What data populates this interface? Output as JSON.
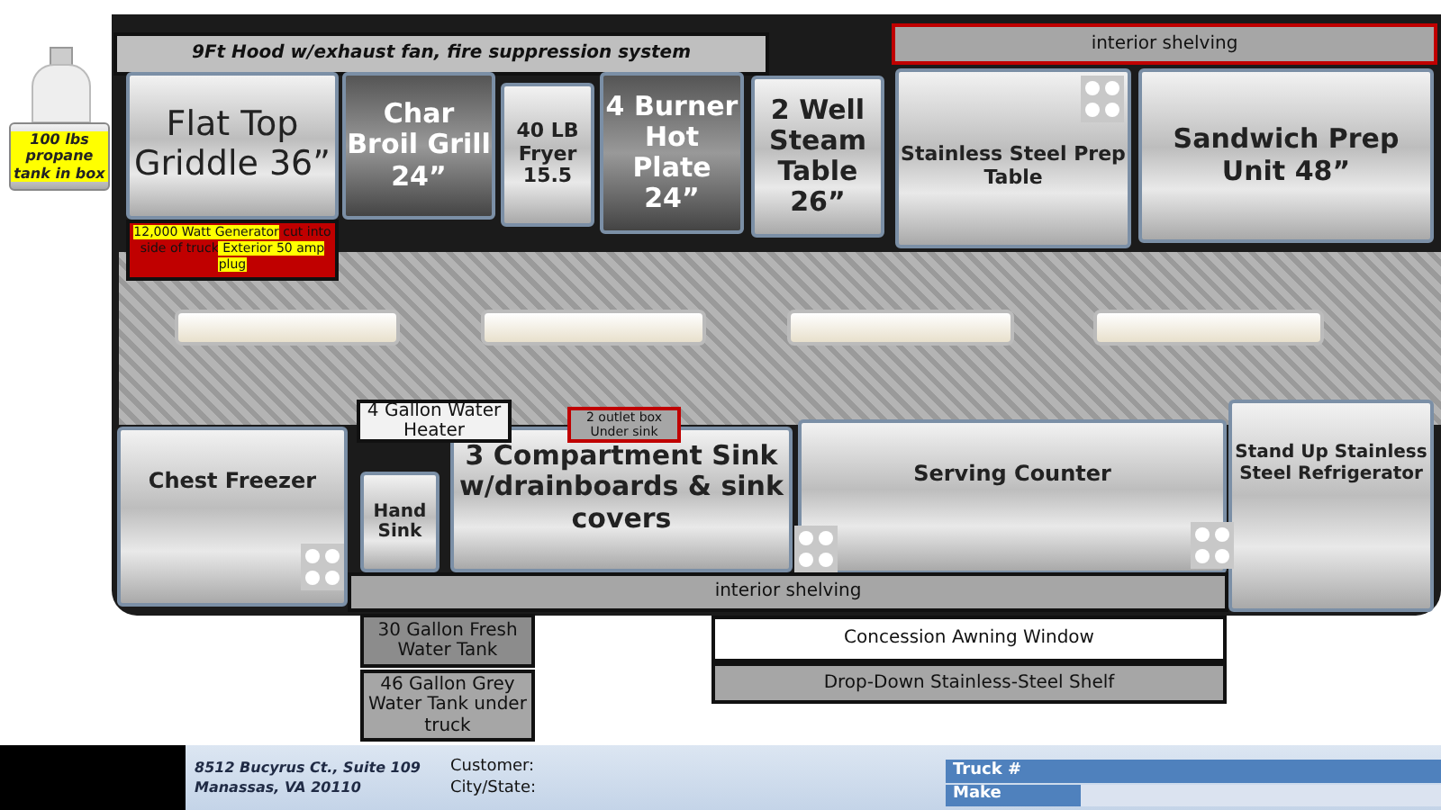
{
  "hood": {
    "label": "9Ft Hood w/exhaust fan, fire suppression  system"
  },
  "propane": {
    "label": "100 lbs propane tank in box"
  },
  "generator": {
    "segments": [
      {
        "text": "12,000 Watt Generator",
        "highlighted": true
      },
      {
        "text": "cut into side of truck",
        "highlighted": false
      },
      {
        "text": "Exterior 50 amp plug",
        "highlighted": true
      }
    ]
  },
  "equipment": [
    {
      "kind": "griddle",
      "label": "Flat Top Griddle 36”"
    },
    {
      "kind": "grill",
      "label": "Char Broil Grill 24”"
    },
    {
      "kind": "fryer",
      "label": "40 LB Fryer 15.5"
    },
    {
      "kind": "hotplate",
      "label": "4 Burner Hot Plate 24”"
    },
    {
      "kind": "steamtable",
      "label": "2 Well Steam Table 26”"
    },
    {
      "kind": "prep",
      "label": "Stainless Steel Prep Table"
    },
    {
      "kind": "sandwich",
      "label": "Sandwich Prep Unit 48”"
    },
    {
      "kind": "freezer",
      "label": "Chest Freezer"
    },
    {
      "kind": "handsink",
      "label": "Hand Sink"
    },
    {
      "kind": "sink3",
      "label": "3 Compartment Sink w/drainboards & sink covers"
    },
    {
      "kind": "counter",
      "label": "Serving Counter"
    },
    {
      "kind": "fridge",
      "label": "Stand Up Stainless Steel Refrigerator"
    }
  ],
  "labels": [
    {
      "kind": "shelf_top",
      "text": "interior shelving"
    },
    {
      "kind": "heater",
      "text": "4 Gallon Water Heater"
    },
    {
      "kind": "outlet_box",
      "text": "2 outlet box Under sink"
    },
    {
      "kind": "shelf_bottom",
      "text": "interior shelving"
    },
    {
      "kind": "fresh_tank",
      "text": "30 Gallon Fresh Water Tank"
    },
    {
      "kind": "grey_tank",
      "text": "46 Gallon Grey Water Tank under truck"
    },
    {
      "kind": "window",
      "text": "Concession Awning Window"
    },
    {
      "kind": "shelf_drop",
      "text": "Drop-Down Stainless-Steel Shelf"
    }
  ],
  "footer": {
    "address": [
      "8512 Bucyrus  Ct., Suite 109",
      "Manassas, VA 20110"
    ],
    "customer_fields": [
      "Customer:",
      "City/State:"
    ],
    "truck_table": [
      "Truck #",
      "Make"
    ]
  }
}
